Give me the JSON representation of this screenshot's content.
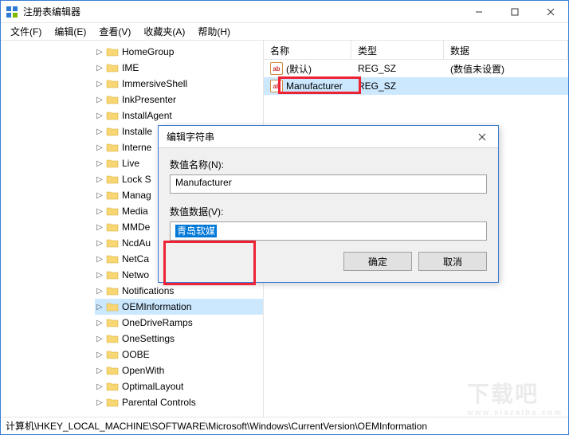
{
  "window": {
    "title": "注册表编辑器"
  },
  "menu": {
    "file": "文件(F)",
    "edit": "编辑(E)",
    "view": "查看(V)",
    "favorites": "收藏夹(A)",
    "help": "帮助(H)"
  },
  "tree": {
    "items": [
      {
        "label": "HomeGroup"
      },
      {
        "label": "IME"
      },
      {
        "label": "ImmersiveShell"
      },
      {
        "label": "InkPresenter"
      },
      {
        "label": "InstallAgent"
      },
      {
        "label": "Installe"
      },
      {
        "label": "Interne"
      },
      {
        "label": "Live"
      },
      {
        "label": "Lock S"
      },
      {
        "label": "Manag"
      },
      {
        "label": "Media"
      },
      {
        "label": "MMDe"
      },
      {
        "label": "NcdAu"
      },
      {
        "label": "NetCa"
      },
      {
        "label": "Netwo"
      },
      {
        "label": "Notifications"
      },
      {
        "label": "OEMInformation",
        "selected": true
      },
      {
        "label": "OneDriveRamps"
      },
      {
        "label": "OneSettings"
      },
      {
        "label": "OOBE"
      },
      {
        "label": "OpenWith"
      },
      {
        "label": "OptimalLayout"
      },
      {
        "label": "Parental Controls"
      }
    ]
  },
  "list": {
    "headers": {
      "name": "名称",
      "type": "类型",
      "data": "数据"
    },
    "rows": [
      {
        "name": "(默认)",
        "type": "REG_SZ",
        "data": "(数值未设置)"
      },
      {
        "name": "Manufacturer",
        "type": "REG_SZ",
        "data": "",
        "selected": true
      }
    ]
  },
  "dialog": {
    "title": "编辑字符串",
    "name_label": "数值名称(N):",
    "name_value": "Manufacturer",
    "data_label": "数值数据(V):",
    "data_value": "青岛软媒",
    "ok": "确定",
    "cancel": "取消"
  },
  "statusbar": {
    "path": "计算机\\HKEY_LOCAL_MACHINE\\SOFTWARE\\Microsoft\\Windows\\CurrentVersion\\OEMInformation"
  },
  "watermark": {
    "main": "下载吧",
    "sub": "www.xiazaiba.com"
  }
}
